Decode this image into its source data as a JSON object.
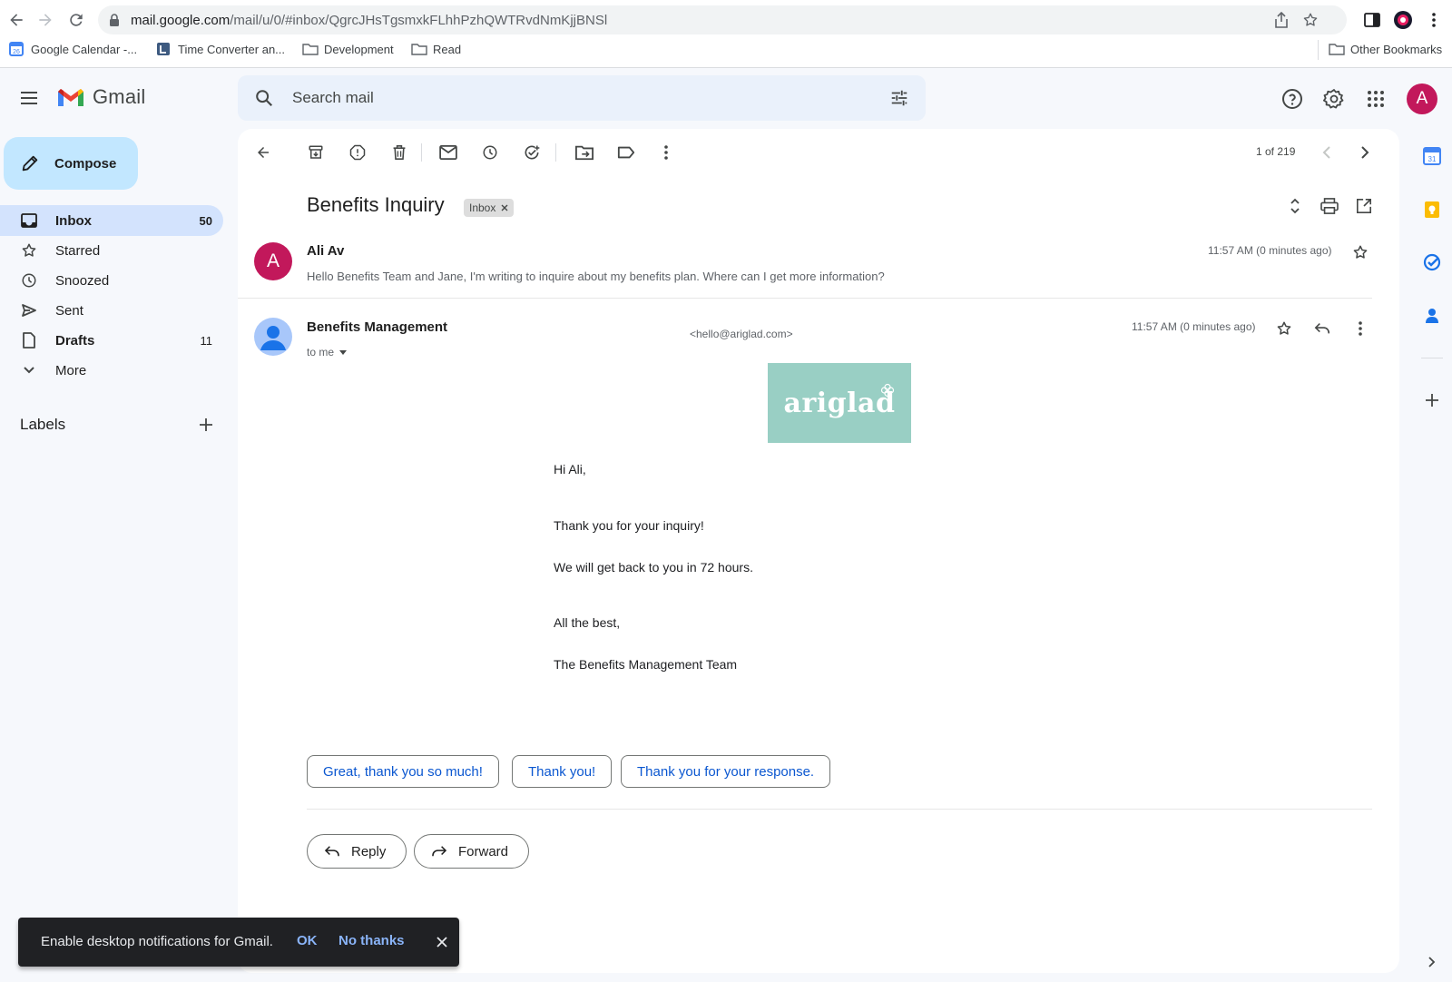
{
  "browser": {
    "url_host": "mail.google.com",
    "url_path": "/mail/u/0/#inbox/QgrcJHsTgsmxkFLhhPzhQWTRvdNmKjjBNSl",
    "bookmarks": [
      {
        "label": "Google Calendar -...",
        "icon": "calendar-icon"
      },
      {
        "label": "Time Converter an...",
        "icon": "clock-icon"
      },
      {
        "label": "Development",
        "icon": "folder-icon"
      },
      {
        "label": "Read",
        "icon": "folder-icon"
      }
    ],
    "other_bookmarks": "Other Bookmarks"
  },
  "gmail": {
    "app_name": "Gmail",
    "search_placeholder": "Search mail",
    "account_initial": "A",
    "compose_label": "Compose",
    "nav": [
      {
        "label": "Inbox",
        "count": "50",
        "icon": "inbox-icon",
        "active": true,
        "bold": true
      },
      {
        "label": "Starred",
        "count": "",
        "icon": "star-icon"
      },
      {
        "label": "Snoozed",
        "count": "",
        "icon": "clock-icon"
      },
      {
        "label": "Sent",
        "count": "",
        "icon": "send-icon"
      },
      {
        "label": "Drafts",
        "count": "11",
        "icon": "file-icon",
        "bold": true
      },
      {
        "label": "More",
        "count": "",
        "icon": "chevron-down-icon"
      }
    ],
    "labels_title": "Labels"
  },
  "thread": {
    "pager": "1 of 219",
    "subject": "Benefits Inquiry",
    "label_chip": "Inbox",
    "message1": {
      "avatar_initial": "A",
      "sender": "Ali Av",
      "snippet": "Hello Benefits Team and Jane, I'm writing to inquire about my benefits plan. Where can I get more information?",
      "time": "11:57 AM (0 minutes ago)"
    },
    "message2": {
      "sender": "Benefits Management",
      "email": "<hello@ariglad.com>",
      "to": "to me",
      "time": "11:57 AM (0 minutes ago)",
      "brand": "ariglad",
      "body": [
        "Hi Ali,",
        "Thank you for your inquiry!",
        "We will get back to you in 72 hours.",
        "All the best,",
        "The Benefits Management Team"
      ]
    },
    "smart_replies": [
      "Great, thank you so much!",
      "Thank you!",
      "Thank you for your response."
    ],
    "reply_label": "Reply",
    "forward_label": "Forward"
  },
  "snackbar": {
    "text": "Enable desktop notifications for Gmail.",
    "ok": "OK",
    "no_thanks": "No thanks"
  },
  "colors": {
    "accent": "#0b57d0",
    "avatar": "#c2185b",
    "compose": "#c2e7ff",
    "active_nav": "#d3e3fd",
    "brand_bg": "#99cfc4"
  }
}
